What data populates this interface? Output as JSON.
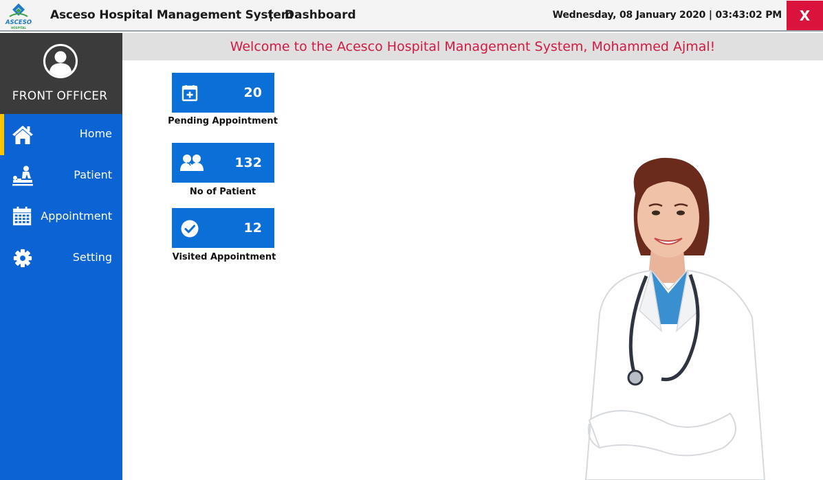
{
  "titlebar": {
    "app_title": "Asceso Hospital Management System",
    "separator": "|",
    "page_name": "Dashboard",
    "datetime": "Wednesday, 08 January 2020 | 03:43:02 PM",
    "close_label": "X",
    "logo_text": "ASCESO",
    "logo_subtext": "HOSPITAL"
  },
  "profile": {
    "role": "FRONT OFFICER",
    "avatar_icon": "user-avatar-icon"
  },
  "sidebar": {
    "items": [
      {
        "label": "Home",
        "icon": "home-icon",
        "active": true
      },
      {
        "label": "Patient",
        "icon": "patient-icon",
        "active": false
      },
      {
        "label": "Appointment",
        "icon": "calendar-icon",
        "active": false
      },
      {
        "label": "Setting",
        "icon": "gear-icon",
        "active": false
      }
    ]
  },
  "welcome": {
    "message": "Welcome to the Acesco Hospital Management System, Mohammed Ajmal!"
  },
  "tiles": [
    {
      "value": "20",
      "label": "Pending Appointment",
      "icon": "calendar-plus-icon"
    },
    {
      "value": "132",
      "label": "No of Patient",
      "icon": "users-icon"
    },
    {
      "value": "12",
      "label": "Visited Appointment",
      "icon": "check-circle-icon"
    }
  ],
  "colors": {
    "sidebar": "#0b63d4",
    "profile_bg": "#3b3b3b",
    "tile": "#0b6fd8",
    "welcome_text": "#d11a42",
    "close_button": "#d9133b",
    "active_indicator": "#ffc400"
  }
}
